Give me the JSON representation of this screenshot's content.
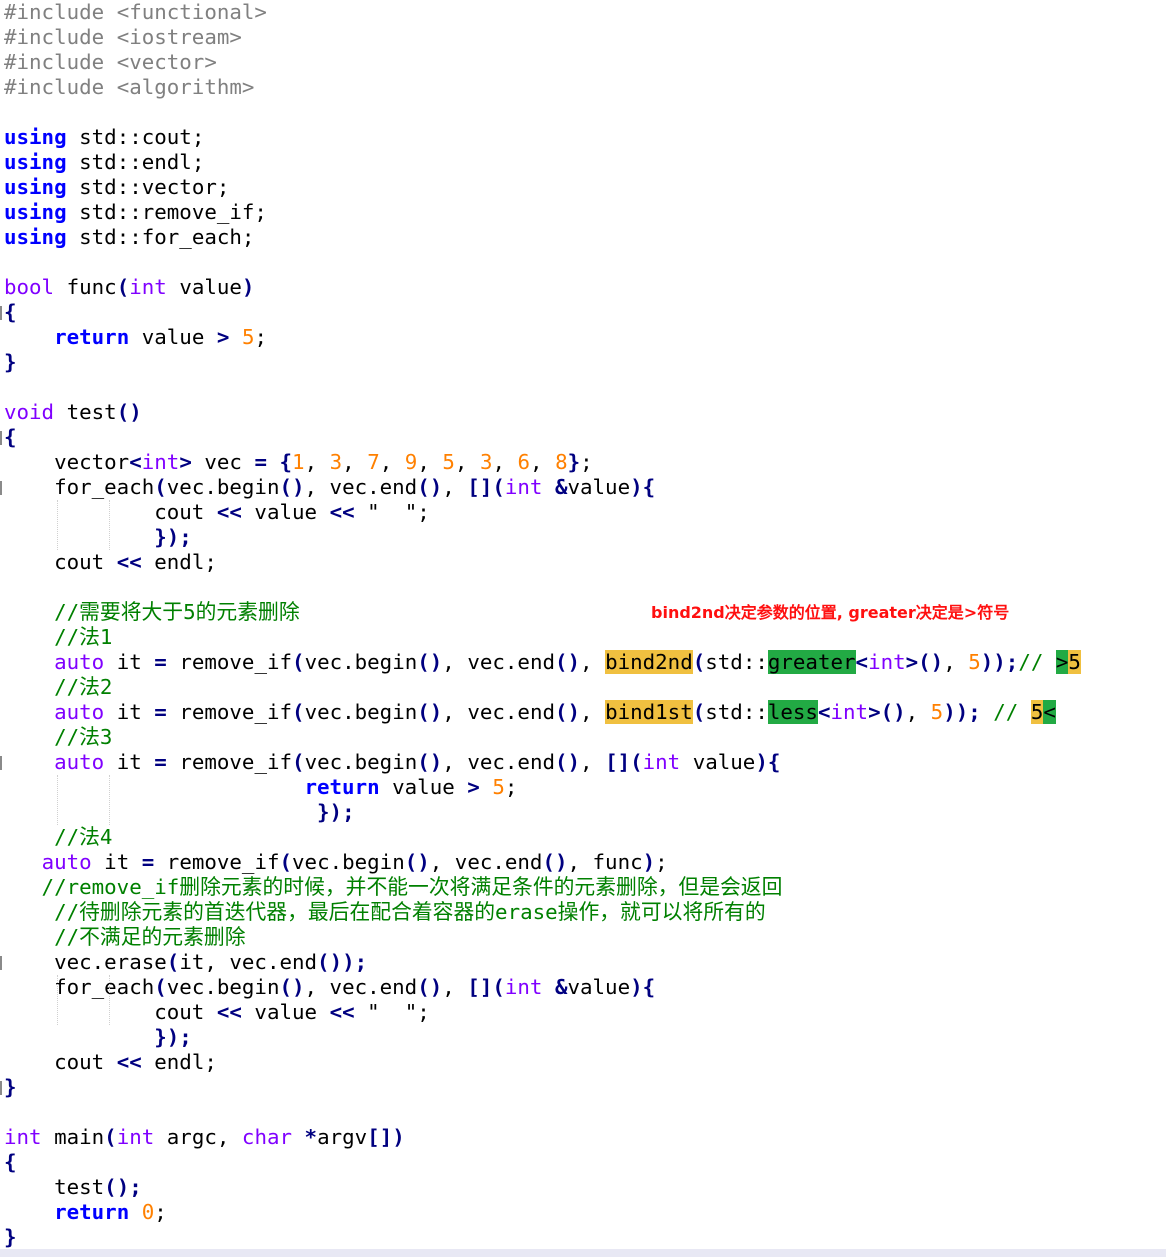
{
  "code_lines": [
    [
      {
        "t": "#include ",
        "c": "gray"
      },
      {
        "t": "<functional>",
        "c": "gray"
      }
    ],
    [
      {
        "t": "#include ",
        "c": "gray"
      },
      {
        "t": "<iostream>",
        "c": "gray"
      }
    ],
    [
      {
        "t": "#include ",
        "c": "gray"
      },
      {
        "t": "<vector>",
        "c": "gray"
      }
    ],
    [
      {
        "t": "#include ",
        "c": "gray"
      },
      {
        "t": "<algorithm>",
        "c": "gray"
      }
    ],
    [],
    [
      {
        "t": "using",
        "c": "kw"
      },
      {
        "t": " std::cout;"
      }
    ],
    [
      {
        "t": "using",
        "c": "kw"
      },
      {
        "t": " std::endl;"
      }
    ],
    [
      {
        "t": "using",
        "c": "kw"
      },
      {
        "t": " std::vector;"
      }
    ],
    [
      {
        "t": "using",
        "c": "kw"
      },
      {
        "t": " std::remove_if;"
      }
    ],
    [
      {
        "t": "using",
        "c": "kw"
      },
      {
        "t": " std::for_each;"
      }
    ],
    [],
    [
      {
        "t": "bool",
        "c": "ty"
      },
      {
        "t": " func"
      },
      {
        "t": "(",
        "c": "op"
      },
      {
        "t": "int",
        "c": "ty"
      },
      {
        "t": " value"
      },
      {
        "t": ")",
        "c": "op"
      }
    ],
    [
      {
        "t": "{",
        "c": "op"
      }
    ],
    [
      {
        "t": "    "
      },
      {
        "t": "return",
        "c": "kw"
      },
      {
        "t": " value "
      },
      {
        "t": ">",
        "c": "op"
      },
      {
        "t": " "
      },
      {
        "t": "5",
        "c": "num"
      },
      {
        "t": ";"
      }
    ],
    [
      {
        "t": "}",
        "c": "op"
      }
    ],
    [],
    [
      {
        "t": "void",
        "c": "ty"
      },
      {
        "t": " test"
      },
      {
        "t": "()",
        "c": "op"
      }
    ],
    [
      {
        "t": "{",
        "c": "op"
      }
    ],
    [
      {
        "t": "    vector"
      },
      {
        "t": "<",
        "c": "op"
      },
      {
        "t": "int",
        "c": "ty"
      },
      {
        "t": ">",
        "c": "op"
      },
      {
        "t": " vec "
      },
      {
        "t": "=",
        "c": "op"
      },
      {
        "t": " "
      },
      {
        "t": "{",
        "c": "op"
      },
      {
        "t": "1",
        "c": "num"
      },
      {
        "t": ", "
      },
      {
        "t": "3",
        "c": "num"
      },
      {
        "t": ", "
      },
      {
        "t": "7",
        "c": "num"
      },
      {
        "t": ", "
      },
      {
        "t": "9",
        "c": "num"
      },
      {
        "t": ", "
      },
      {
        "t": "5",
        "c": "num"
      },
      {
        "t": ", "
      },
      {
        "t": "3",
        "c": "num"
      },
      {
        "t": ", "
      },
      {
        "t": "6",
        "c": "num"
      },
      {
        "t": ", "
      },
      {
        "t": "8",
        "c": "num"
      },
      {
        "t": "}",
        "c": "op"
      },
      {
        "t": ";"
      }
    ],
    [
      {
        "t": "    for_each"
      },
      {
        "t": "(",
        "c": "op"
      },
      {
        "t": "vec.begin"
      },
      {
        "t": "()",
        "c": "op"
      },
      {
        "t": ", vec.end"
      },
      {
        "t": "()",
        "c": "op"
      },
      {
        "t": ", "
      },
      {
        "t": "[](",
        "c": "op"
      },
      {
        "t": "int",
        "c": "ty"
      },
      {
        "t": " "
      },
      {
        "t": "&",
        "c": "op"
      },
      {
        "t": "value"
      },
      {
        "t": "){",
        "c": "op"
      }
    ],
    [
      {
        "t": "            cout "
      },
      {
        "t": "<<",
        "c": "op"
      },
      {
        "t": " value "
      },
      {
        "t": "<<",
        "c": "op"
      },
      {
        "t": " \"  \";"
      }
    ],
    [
      {
        "t": "            "
      },
      {
        "t": "});",
        "c": "op"
      }
    ],
    [
      {
        "t": "    cout "
      },
      {
        "t": "<<",
        "c": "op"
      },
      {
        "t": " endl;"
      }
    ],
    [],
    [
      {
        "t": "    //需要将大于5的元素删除",
        "c": "cm"
      }
    ],
    [
      {
        "t": "    //法1",
        "c": "cm"
      }
    ],
    [
      {
        "t": "    "
      },
      {
        "t": "auto",
        "c": "ty"
      },
      {
        "t": " it "
      },
      {
        "t": "=",
        "c": "op"
      },
      {
        "t": " remove_if"
      },
      {
        "t": "(",
        "c": "op"
      },
      {
        "t": "vec.begin"
      },
      {
        "t": "()",
        "c": "op"
      },
      {
        "t": ", vec.end"
      },
      {
        "t": "()",
        "c": "op"
      },
      {
        "t": ", "
      },
      {
        "t": "bind2nd",
        "c": "hl-y"
      },
      {
        "t": "(",
        "c": "op"
      },
      {
        "t": "std::"
      },
      {
        "t": "greater",
        "c": "hl-g"
      },
      {
        "t": "<",
        "c": "op"
      },
      {
        "t": "int",
        "c": "ty"
      },
      {
        "t": ">()",
        "c": "op"
      },
      {
        "t": ", "
      },
      {
        "t": "5",
        "c": "num"
      },
      {
        "t": "));",
        "c": "op"
      },
      {
        "t": "// ",
        "c": "cm"
      },
      {
        "t": ">",
        "c": "hl-g"
      },
      {
        "t": "5",
        "c": "hl-y"
      }
    ],
    [
      {
        "t": "    //法2",
        "c": "cm"
      }
    ],
    [
      {
        "t": "    "
      },
      {
        "t": "auto",
        "c": "ty"
      },
      {
        "t": " it "
      },
      {
        "t": "=",
        "c": "op"
      },
      {
        "t": " remove_if"
      },
      {
        "t": "(",
        "c": "op"
      },
      {
        "t": "vec.begin"
      },
      {
        "t": "()",
        "c": "op"
      },
      {
        "t": ", vec.end"
      },
      {
        "t": "()",
        "c": "op"
      },
      {
        "t": ", "
      },
      {
        "t": "bind1st",
        "c": "hl-y"
      },
      {
        "t": "(",
        "c": "op"
      },
      {
        "t": "std::"
      },
      {
        "t": "less",
        "c": "hl-g"
      },
      {
        "t": "<",
        "c": "op"
      },
      {
        "t": "int",
        "c": "ty"
      },
      {
        "t": ">()",
        "c": "op"
      },
      {
        "t": ", "
      },
      {
        "t": "5",
        "c": "num"
      },
      {
        "t": "));",
        "c": "op"
      },
      {
        "t": " // ",
        "c": "cm"
      },
      {
        "t": "5",
        "c": "hl-y"
      },
      {
        "t": "<",
        "c": "hl-g"
      }
    ],
    [
      {
        "t": "    //法3",
        "c": "cm"
      }
    ],
    [
      {
        "t": "    "
      },
      {
        "t": "auto",
        "c": "ty"
      },
      {
        "t": " it "
      },
      {
        "t": "=",
        "c": "op"
      },
      {
        "t": " remove_if"
      },
      {
        "t": "(",
        "c": "op"
      },
      {
        "t": "vec.begin"
      },
      {
        "t": "()",
        "c": "op"
      },
      {
        "t": ", vec.end"
      },
      {
        "t": "()",
        "c": "op"
      },
      {
        "t": ", "
      },
      {
        "t": "[](",
        "c": "op"
      },
      {
        "t": "int",
        "c": "ty"
      },
      {
        "t": " value"
      },
      {
        "t": "){",
        "c": "op"
      }
    ],
    [
      {
        "t": "                        "
      },
      {
        "t": "return",
        "c": "kw"
      },
      {
        "t": " value "
      },
      {
        "t": ">",
        "c": "op"
      },
      {
        "t": " "
      },
      {
        "t": "5",
        "c": "num"
      },
      {
        "t": ";"
      }
    ],
    [
      {
        "t": "                         "
      },
      {
        "t": "});",
        "c": "op"
      }
    ],
    [
      {
        "t": "    //法4",
        "c": "cm"
      }
    ],
    [
      {
        "t": "   "
      },
      {
        "t": "auto",
        "c": "ty"
      },
      {
        "t": " it "
      },
      {
        "t": "=",
        "c": "op"
      },
      {
        "t": " remove_if"
      },
      {
        "t": "(",
        "c": "op"
      },
      {
        "t": "vec.begin"
      },
      {
        "t": "()",
        "c": "op"
      },
      {
        "t": ", vec.end"
      },
      {
        "t": "()",
        "c": "op"
      },
      {
        "t": ", func"
      },
      {
        "t": ")",
        "c": "op"
      },
      {
        "t": ";"
      }
    ],
    [
      {
        "t": "   //remove_if删除元素的时候，并不能一次将满足条件的元素删除，但是会返回",
        "c": "cm"
      }
    ],
    [
      {
        "t": "    //待删除元素的首迭代器，最后在配合着容器的erase操作，就可以将所有的",
        "c": "cm"
      }
    ],
    [
      {
        "t": "    //不满足的元素删除",
        "c": "cm"
      }
    ],
    [
      {
        "t": "    vec.erase"
      },
      {
        "t": "(",
        "c": "op"
      },
      {
        "t": "it, vec.end"
      },
      {
        "t": "()",
        "c": "op"
      },
      {
        "t": ");",
        "c": "op"
      }
    ],
    [
      {
        "t": "    for_each"
      },
      {
        "t": "(",
        "c": "op"
      },
      {
        "t": "vec.begin"
      },
      {
        "t": "()",
        "c": "op"
      },
      {
        "t": ", vec.end"
      },
      {
        "t": "()",
        "c": "op"
      },
      {
        "t": ", "
      },
      {
        "t": "[](",
        "c": "op"
      },
      {
        "t": "int",
        "c": "ty"
      },
      {
        "t": " "
      },
      {
        "t": "&",
        "c": "op"
      },
      {
        "t": "value"
      },
      {
        "t": "){",
        "c": "op"
      }
    ],
    [
      {
        "t": "            cout "
      },
      {
        "t": "<<",
        "c": "op"
      },
      {
        "t": " value "
      },
      {
        "t": "<<",
        "c": "op"
      },
      {
        "t": " \"  \";"
      }
    ],
    [
      {
        "t": "            "
      },
      {
        "t": "});",
        "c": "op"
      }
    ],
    [
      {
        "t": "    cout "
      },
      {
        "t": "<<",
        "c": "op"
      },
      {
        "t": " endl;"
      }
    ],
    [
      {
        "t": "}",
        "c": "op"
      }
    ],
    [],
    [
      {
        "t": "int",
        "c": "ty"
      },
      {
        "t": " main"
      },
      {
        "t": "(",
        "c": "op"
      },
      {
        "t": "int",
        "c": "ty"
      },
      {
        "t": " argc, "
      },
      {
        "t": "char",
        "c": "ty"
      },
      {
        "t": " "
      },
      {
        "t": "*",
        "c": "op"
      },
      {
        "t": "argv"
      },
      {
        "t": "[])",
        "c": "op"
      }
    ],
    [
      {
        "t": "{",
        "c": "op"
      }
    ],
    [
      {
        "t": "    test"
      },
      {
        "t": "();",
        "c": "op"
      }
    ],
    [
      {
        "t": "    "
      },
      {
        "t": "return",
        "c": "kw"
      },
      {
        "t": " "
      },
      {
        "t": "0",
        "c": "num"
      },
      {
        "t": ";"
      }
    ],
    [
      {
        "t": "}",
        "c": "op"
      }
    ]
  ],
  "annotation": "bind2nd决定参数的位置, greater决定是>符号",
  "colors": {
    "keyword": "#0000ff",
    "type": "#8000ff",
    "number": "#ff8000",
    "comment": "#008000",
    "preprocessor": "#808080",
    "operator": "#000080",
    "highlight_yellow": "#f0c040",
    "highlight_green": "#22aa44",
    "annotation": "#ff1010"
  }
}
